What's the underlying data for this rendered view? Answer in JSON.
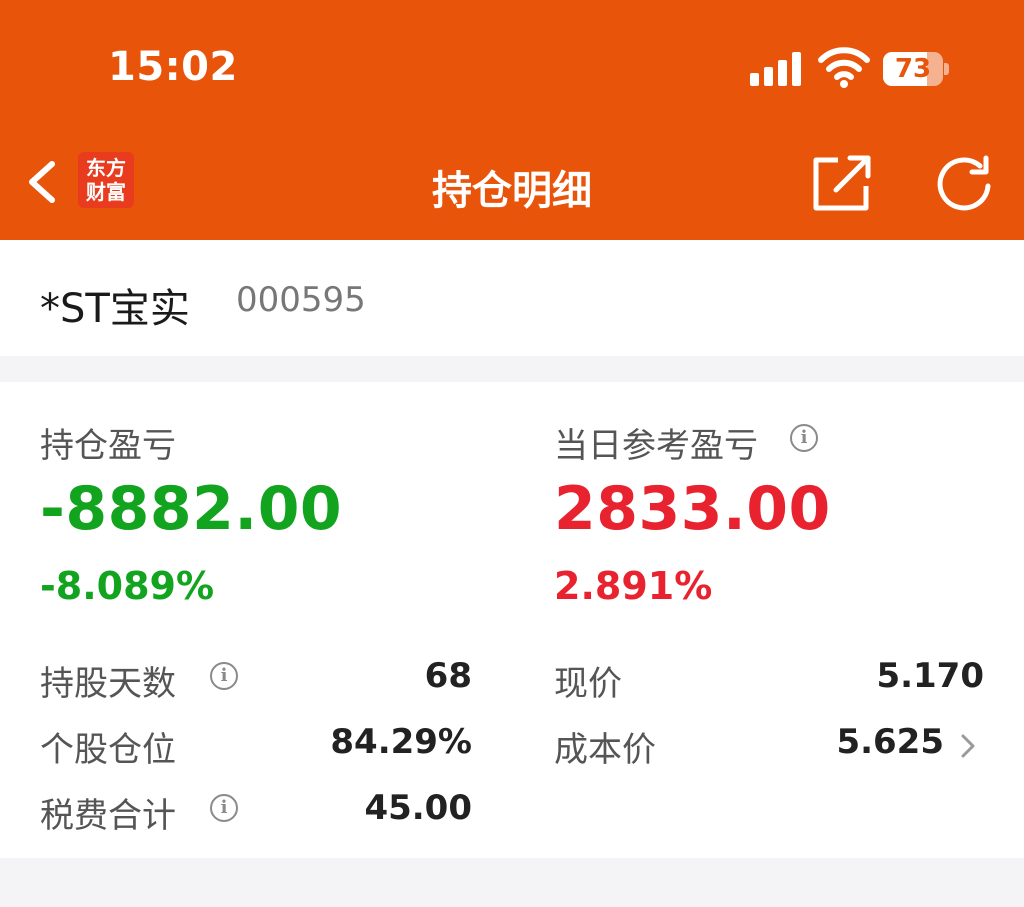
{
  "status_bar": {
    "time": "15:02",
    "battery": "73",
    "battery_level": 0.73,
    "icons": [
      "signal-icon",
      "wifi-icon",
      "battery-icon"
    ]
  },
  "nav": {
    "title": "持仓明细",
    "logo_line1": "东方",
    "logo_line2": "财富",
    "icons": [
      "back-chevron-icon",
      "share-icon",
      "refresh-icon"
    ]
  },
  "stock": {
    "name": "*ST宝实",
    "code": "000595"
  },
  "pnl": {
    "holding": {
      "label": "持仓盈亏",
      "value": "-8882.00",
      "percent": "-8.089%"
    },
    "daily": {
      "label": "当日参考盈亏",
      "value": "2833.00",
      "percent": "2.891%"
    }
  },
  "details": {
    "left": [
      {
        "label": "持股天数",
        "value": "68",
        "info": true
      },
      {
        "label": "个股仓位",
        "value": "84.29%",
        "info": false
      },
      {
        "label": "税费合计",
        "value": "45.00",
        "info": true
      }
    ],
    "right": [
      {
        "label": "现价",
        "value": "5.170"
      },
      {
        "label": "成本价",
        "value": "5.625"
      }
    ]
  },
  "colors": {
    "header": "#e8540a",
    "loss": "#12a31f",
    "gain": "#e8222e"
  }
}
